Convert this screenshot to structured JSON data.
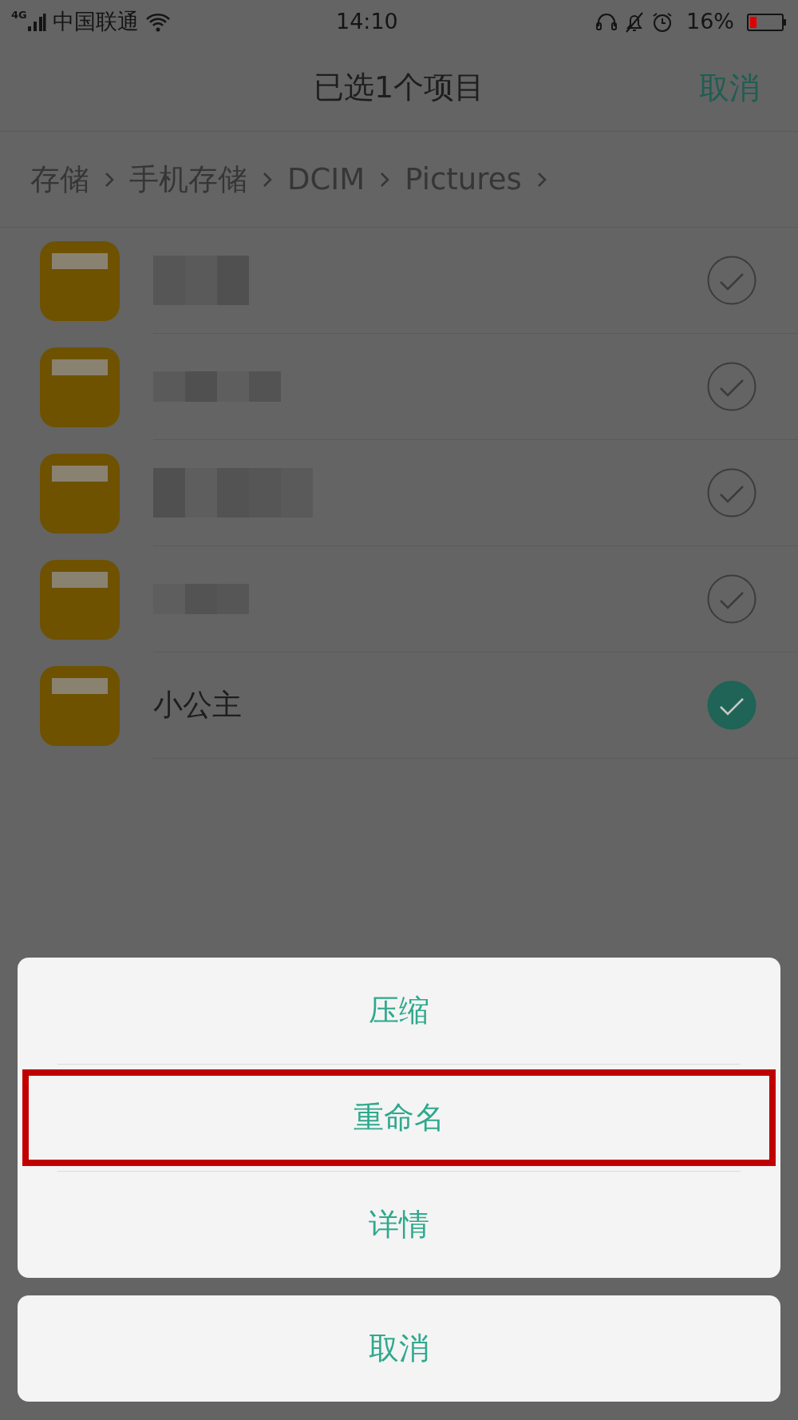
{
  "status_bar": {
    "network": "4G",
    "carrier": "中国联通",
    "time": "14:10",
    "battery": "16%"
  },
  "header": {
    "title": "已选1个项目",
    "cancel": "取消"
  },
  "breadcrumb": [
    "存储",
    "手机存储",
    "DCIM",
    "Pictures"
  ],
  "folders": [
    {
      "blurred": true,
      "selected": false
    },
    {
      "blurred": true,
      "selected": false
    },
    {
      "blurred": true,
      "selected": false
    },
    {
      "blurred": true,
      "selected": false
    },
    {
      "name": "小公主",
      "blurred": false,
      "selected": true
    }
  ],
  "action_sheet": {
    "items": [
      {
        "label": "压缩",
        "highlighted": false
      },
      {
        "label": "重命名",
        "highlighted": true
      },
      {
        "label": "详情",
        "highlighted": false
      }
    ],
    "cancel": "取消"
  }
}
